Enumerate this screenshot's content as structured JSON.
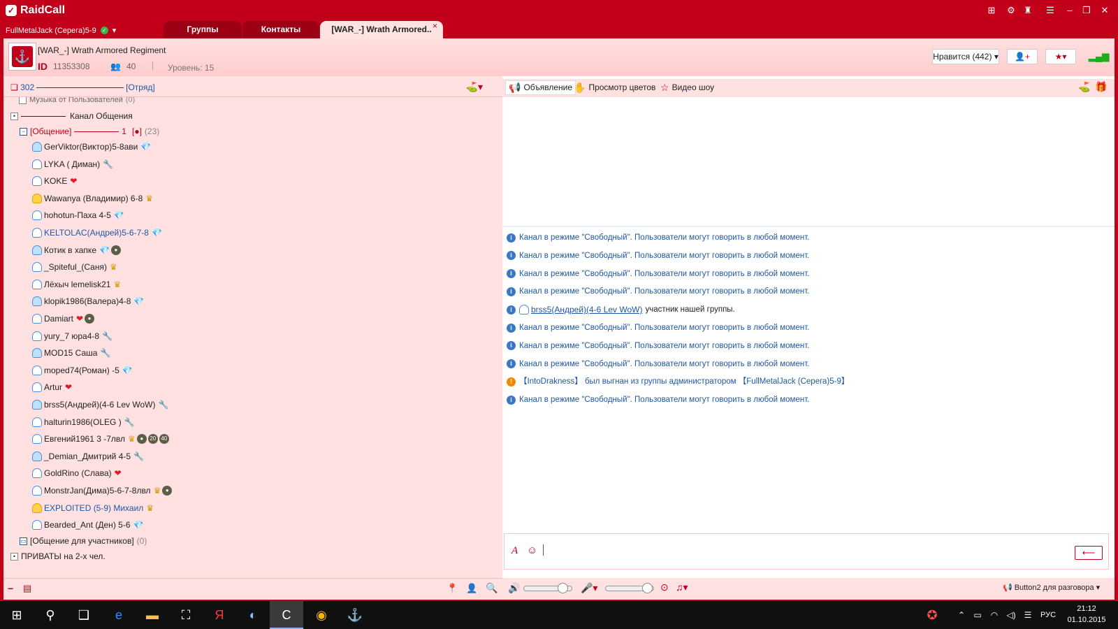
{
  "app": {
    "name": "RaidCall"
  },
  "window_icons": [
    "gamepad-icon",
    "settings-icon",
    "shirt-icon",
    "menu-icon",
    "minimize-icon",
    "maximize-icon",
    "close-icon"
  ],
  "user": {
    "name": "FullMetalJack (Серега)5-9"
  },
  "tabs": [
    {
      "label": "Группы"
    },
    {
      "label": "Контакты"
    },
    {
      "label": "[WAR_-] Wrath Armored..",
      "close": "×"
    }
  ],
  "group": {
    "name": "[WAR_-] Wrath Armored Regiment",
    "id_label": "ID",
    "id": "11353308",
    "members": "40",
    "level": "Уровень: 15"
  },
  "header_buttons": {
    "likes": "Нравится (442)"
  },
  "left_panel": {
    "online": "302",
    "squad": "[Отряд]",
    "tree": {
      "top_partial": "Музыка от Пользователей",
      "top_partial_count": "(0)",
      "channel": "Канал Общения",
      "subchannel": {
        "name": "[Общение]",
        "suffix": "1",
        "tag": "[●]",
        "count": "(23)"
      },
      "users": [
        {
          "name": "GerViktor(Виктор)5-8ави",
          "badges": [
            "💎"
          ]
        },
        {
          "name": "LYKA ( Диман)",
          "badges": [
            "🔧"
          ]
        },
        {
          "name": "KOKE",
          "badges": [
            "❤"
          ]
        },
        {
          "name": "Wawanya (Владимир) 6-8",
          "badges": [
            "♛"
          ]
        },
        {
          "name": "hohotun-Паха 4-5",
          "badges": [
            "💎"
          ]
        },
        {
          "name": "KELTOLAC(Андрей)5-6-7-8",
          "badges": [
            "💎"
          ]
        },
        {
          "name": "Котик в хапке",
          "badges": [
            "💎",
            "●"
          ]
        },
        {
          "name": "_Spiteful_(Саня)",
          "badges": [
            "♛"
          ]
        },
        {
          "name": "Лёхыч lemelisk21",
          "badges": [
            "♛"
          ]
        },
        {
          "name": "klopik1986(Валера)4-8",
          "badges": [
            "💎"
          ]
        },
        {
          "name": "Damiart",
          "badges": [
            "❤",
            "●"
          ]
        },
        {
          "name": "yury_7 юра4-8",
          "badges": [
            "🔧"
          ]
        },
        {
          "name": "MOD15 Саша",
          "badges": [
            "🔧"
          ]
        },
        {
          "name": "moped74(Роман) -5",
          "badges": [
            "💎"
          ]
        },
        {
          "name": "Artur",
          "badges": [
            "❤"
          ]
        },
        {
          "name": "brss5(Андрей)(4-6 Lev WoW)",
          "badges": [
            "🔧"
          ]
        },
        {
          "name": "halturin1986(OLEG )",
          "badges": [
            "🔧"
          ]
        },
        {
          "name": "Евгений1961 3 -7лвл",
          "badges": [
            "♛",
            "●",
            "20",
            "40"
          ]
        },
        {
          "name": "_Demian_Дмитрий 4-5",
          "badges": [
            "🔧"
          ]
        },
        {
          "name": "GoldRino (Слава)",
          "badges": [
            "❤"
          ]
        },
        {
          "name": "MonstrJan(Дима)5-6-7-8лвл",
          "badges": [
            "♛",
            "●"
          ]
        },
        {
          "name": "EXPLOITED (5-9) Михаил",
          "badges": [
            "♛"
          ]
        },
        {
          "name": "Bearded_Ant (Ден) 5-6",
          "badges": [
            "💎"
          ]
        }
      ],
      "members_channel": {
        "name": "[Общение для участников]",
        "count": "(0)"
      },
      "privates": "ПРИВАТЫ на 2-х чел."
    }
  },
  "right_toolbar": {
    "announcement": "Объявление",
    "view_colors": "Просмотр цветов",
    "video_show": "Видео шоу"
  },
  "messages": [
    {
      "type": "info",
      "text": "Канал в режиме \"Свободный\". Пользователи могут говорить в любой момент."
    },
    {
      "type": "info",
      "text": "Канал в режиме \"Свободный\". Пользователи могут говорить в любой момент."
    },
    {
      "type": "info",
      "text": "Канал в режиме \"Свободный\". Пользователи могут говорить в любой момент."
    },
    {
      "type": "info",
      "text": "Канал в режиме \"Свободный\". Пользователи могут говорить в любой момент."
    },
    {
      "type": "member",
      "user": "brss5(Андрей)(4-6 Lev WoW)",
      "text": "участник нашей группы."
    },
    {
      "type": "info",
      "text": "Канал в режиме \"Свободный\". Пользователи могут говорить в любой момент."
    },
    {
      "type": "info",
      "text": "Канал в режиме \"Свободный\". Пользователи могут говорить в любой момент."
    },
    {
      "type": "info",
      "text": "Канал в режиме \"Свободный\". Пользователи могут говорить в любой момент."
    },
    {
      "type": "warn",
      "text": "【IntoDrakness】 был выгнан из группы администратором 【FullMetalJack (Серега)5-9】"
    },
    {
      "type": "info",
      "text": "Канал в режиме \"Свободный\". Пользователи могут говорить в любой момент."
    }
  ],
  "bottom_bar": {
    "ptt": "Button2 для разговора"
  },
  "taskbar": {
    "lang": "РУС",
    "time": "21:12",
    "date": "01.10.2015"
  }
}
